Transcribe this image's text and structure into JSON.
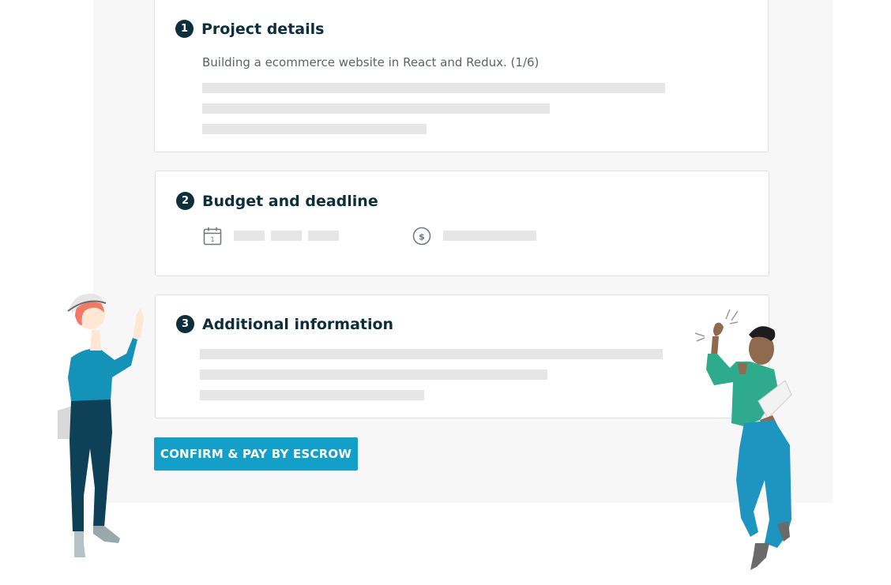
{
  "steps": [
    {
      "number": "1",
      "title": "Project details",
      "description": "Building a ecommerce website in React and Redux. (1/6)"
    },
    {
      "number": "2",
      "title": "Budget and deadline"
    },
    {
      "number": "3",
      "title": "Additional information"
    }
  ],
  "budget": {
    "date_icon": "calendar-icon",
    "budget_icon": "dollar-circle-icon"
  },
  "cta": {
    "label": "CONFIRM & PAY BY ESCROW"
  },
  "colors": {
    "accent": "#139fc8",
    "step_badge": "#0e2e3c",
    "placeholder": "#e6e6e6",
    "panel_background": "#f7f7f7"
  }
}
